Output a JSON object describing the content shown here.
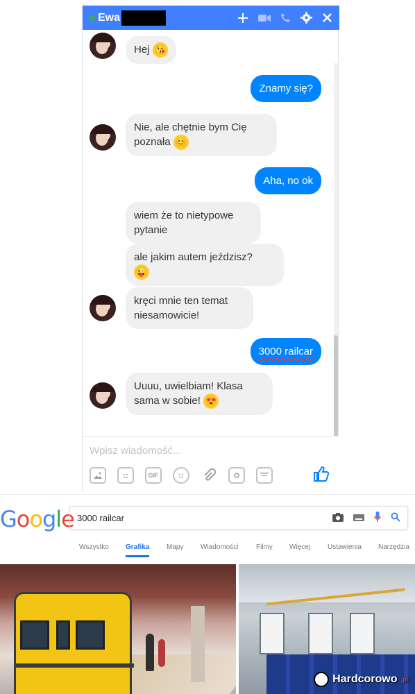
{
  "chat": {
    "contact_name": "Ewa",
    "header_icons": [
      "plus-icon",
      "video-icon",
      "phone-icon",
      "gear-icon",
      "close-icon"
    ],
    "messages": [
      {
        "from": "her",
        "text": "Hej",
        "emoji": "kiss-emoji"
      },
      {
        "from": "me",
        "text": "Znamy się?"
      },
      {
        "from": "her",
        "text": "Nie, ale chętnie bym Cię poznała",
        "emoji": "smile-emoji"
      },
      {
        "from": "me",
        "text": "Aha, no ok"
      },
      {
        "from": "her",
        "text": "wiem że to nietypowe pytanie"
      },
      {
        "from": "her",
        "text": "ale jakim autem jeździsz?",
        "emoji": "wink-emoji"
      },
      {
        "from": "her",
        "text": "kręci mnie ten temat niesamowicie!"
      },
      {
        "from": "me",
        "text": "3000 railcar"
      },
      {
        "from": "her",
        "text": "Uuuu, uwielbiam! Klasa sama w sobie!",
        "emoji": "heart-eyes-emoji"
      }
    ],
    "composer_placeholder": "Wpisz wiadomość...",
    "composer_tools": [
      "image-icon",
      "sticker-icon",
      "gif-icon",
      "emoji-icon",
      "attachment-icon",
      "camera-icon",
      "calendar-icon"
    ],
    "gif_label": "GIF"
  },
  "google": {
    "logo": [
      "G",
      "o",
      "o",
      "g",
      "l",
      "e"
    ],
    "query": "3000 railcar",
    "tabs": [
      "Wszystko",
      "Grafika",
      "Mapy",
      "Wiadomości",
      "Filmy",
      "Więcej",
      "Ustawienia",
      "Narzędzia"
    ],
    "active_tab": "Grafika"
  },
  "watermark": {
    "text": "Hardcorowo",
    "suffix": ".pl"
  },
  "colors": {
    "messenger_blue": "#4080ff",
    "bubble_out": "#0084ff",
    "bubble_in": "#f1f0f0",
    "google_blue": "#1a73e8"
  }
}
